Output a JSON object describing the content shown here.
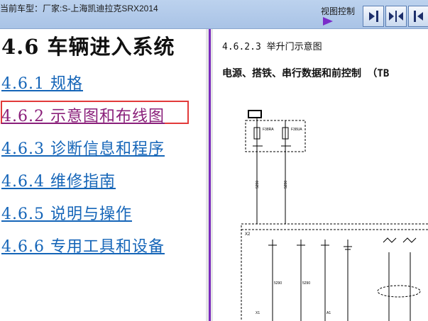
{
  "topbar": {
    "vehicle_text": "当前车型：厂家:S-上海凯迪拉克SRX2014",
    "view_control_label": "视图控制"
  },
  "left": {
    "title": "4.6  车辆进入系统",
    "links": [
      "4.6.1  规格",
      "4.6.2  示意图和布线图",
      "4.6.3  诊断信息和程序",
      "4.6.4  维修指南",
      "4.6.5  说明与操作",
      "4.6.6  专用工具和设备"
    ]
  },
  "right": {
    "section": "4.6.2.3  举升门示意图",
    "subtitle": "电源、搭铁、串行数据和前控制 （TB",
    "diagram": {
      "fuse_labels": [
        "F38RA",
        "F38UA"
      ],
      "wire_labels": [
        "5290",
        "5290",
        "5290",
        "5290"
      ],
      "connector_labels": [
        "X2",
        "X3",
        "X1",
        "A1"
      ]
    }
  },
  "colors": {
    "link": "#1565b8",
    "visited_link": "#8a1f7a",
    "highlight_border": "#e23a3a",
    "splitter": "#7b2cbf"
  }
}
